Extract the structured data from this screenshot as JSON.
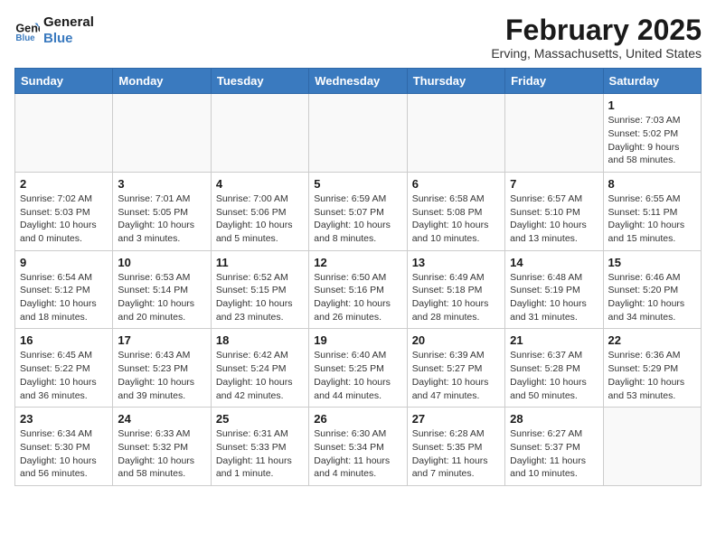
{
  "header": {
    "logo_line1": "General",
    "logo_line2": "Blue",
    "month_year": "February 2025",
    "location": "Erving, Massachusetts, United States"
  },
  "days_of_week": [
    "Sunday",
    "Monday",
    "Tuesday",
    "Wednesday",
    "Thursday",
    "Friday",
    "Saturday"
  ],
  "weeks": [
    [
      {
        "day": "",
        "info": ""
      },
      {
        "day": "",
        "info": ""
      },
      {
        "day": "",
        "info": ""
      },
      {
        "day": "",
        "info": ""
      },
      {
        "day": "",
        "info": ""
      },
      {
        "day": "",
        "info": ""
      },
      {
        "day": "1",
        "info": "Sunrise: 7:03 AM\nSunset: 5:02 PM\nDaylight: 9 hours and 58 minutes."
      }
    ],
    [
      {
        "day": "2",
        "info": "Sunrise: 7:02 AM\nSunset: 5:03 PM\nDaylight: 10 hours and 0 minutes."
      },
      {
        "day": "3",
        "info": "Sunrise: 7:01 AM\nSunset: 5:05 PM\nDaylight: 10 hours and 3 minutes."
      },
      {
        "day": "4",
        "info": "Sunrise: 7:00 AM\nSunset: 5:06 PM\nDaylight: 10 hours and 5 minutes."
      },
      {
        "day": "5",
        "info": "Sunrise: 6:59 AM\nSunset: 5:07 PM\nDaylight: 10 hours and 8 minutes."
      },
      {
        "day": "6",
        "info": "Sunrise: 6:58 AM\nSunset: 5:08 PM\nDaylight: 10 hours and 10 minutes."
      },
      {
        "day": "7",
        "info": "Sunrise: 6:57 AM\nSunset: 5:10 PM\nDaylight: 10 hours and 13 minutes."
      },
      {
        "day": "8",
        "info": "Sunrise: 6:55 AM\nSunset: 5:11 PM\nDaylight: 10 hours and 15 minutes."
      }
    ],
    [
      {
        "day": "9",
        "info": "Sunrise: 6:54 AM\nSunset: 5:12 PM\nDaylight: 10 hours and 18 minutes."
      },
      {
        "day": "10",
        "info": "Sunrise: 6:53 AM\nSunset: 5:14 PM\nDaylight: 10 hours and 20 minutes."
      },
      {
        "day": "11",
        "info": "Sunrise: 6:52 AM\nSunset: 5:15 PM\nDaylight: 10 hours and 23 minutes."
      },
      {
        "day": "12",
        "info": "Sunrise: 6:50 AM\nSunset: 5:16 PM\nDaylight: 10 hours and 26 minutes."
      },
      {
        "day": "13",
        "info": "Sunrise: 6:49 AM\nSunset: 5:18 PM\nDaylight: 10 hours and 28 minutes."
      },
      {
        "day": "14",
        "info": "Sunrise: 6:48 AM\nSunset: 5:19 PM\nDaylight: 10 hours and 31 minutes."
      },
      {
        "day": "15",
        "info": "Sunrise: 6:46 AM\nSunset: 5:20 PM\nDaylight: 10 hours and 34 minutes."
      }
    ],
    [
      {
        "day": "16",
        "info": "Sunrise: 6:45 AM\nSunset: 5:22 PM\nDaylight: 10 hours and 36 minutes."
      },
      {
        "day": "17",
        "info": "Sunrise: 6:43 AM\nSunset: 5:23 PM\nDaylight: 10 hours and 39 minutes."
      },
      {
        "day": "18",
        "info": "Sunrise: 6:42 AM\nSunset: 5:24 PM\nDaylight: 10 hours and 42 minutes."
      },
      {
        "day": "19",
        "info": "Sunrise: 6:40 AM\nSunset: 5:25 PM\nDaylight: 10 hours and 44 minutes."
      },
      {
        "day": "20",
        "info": "Sunrise: 6:39 AM\nSunset: 5:27 PM\nDaylight: 10 hours and 47 minutes."
      },
      {
        "day": "21",
        "info": "Sunrise: 6:37 AM\nSunset: 5:28 PM\nDaylight: 10 hours and 50 minutes."
      },
      {
        "day": "22",
        "info": "Sunrise: 6:36 AM\nSunset: 5:29 PM\nDaylight: 10 hours and 53 minutes."
      }
    ],
    [
      {
        "day": "23",
        "info": "Sunrise: 6:34 AM\nSunset: 5:30 PM\nDaylight: 10 hours and 56 minutes."
      },
      {
        "day": "24",
        "info": "Sunrise: 6:33 AM\nSunset: 5:32 PM\nDaylight: 10 hours and 58 minutes."
      },
      {
        "day": "25",
        "info": "Sunrise: 6:31 AM\nSunset: 5:33 PM\nDaylight: 11 hours and 1 minute."
      },
      {
        "day": "26",
        "info": "Sunrise: 6:30 AM\nSunset: 5:34 PM\nDaylight: 11 hours and 4 minutes."
      },
      {
        "day": "27",
        "info": "Sunrise: 6:28 AM\nSunset: 5:35 PM\nDaylight: 11 hours and 7 minutes."
      },
      {
        "day": "28",
        "info": "Sunrise: 6:27 AM\nSunset: 5:37 PM\nDaylight: 11 hours and 10 minutes."
      },
      {
        "day": "",
        "info": ""
      }
    ]
  ]
}
